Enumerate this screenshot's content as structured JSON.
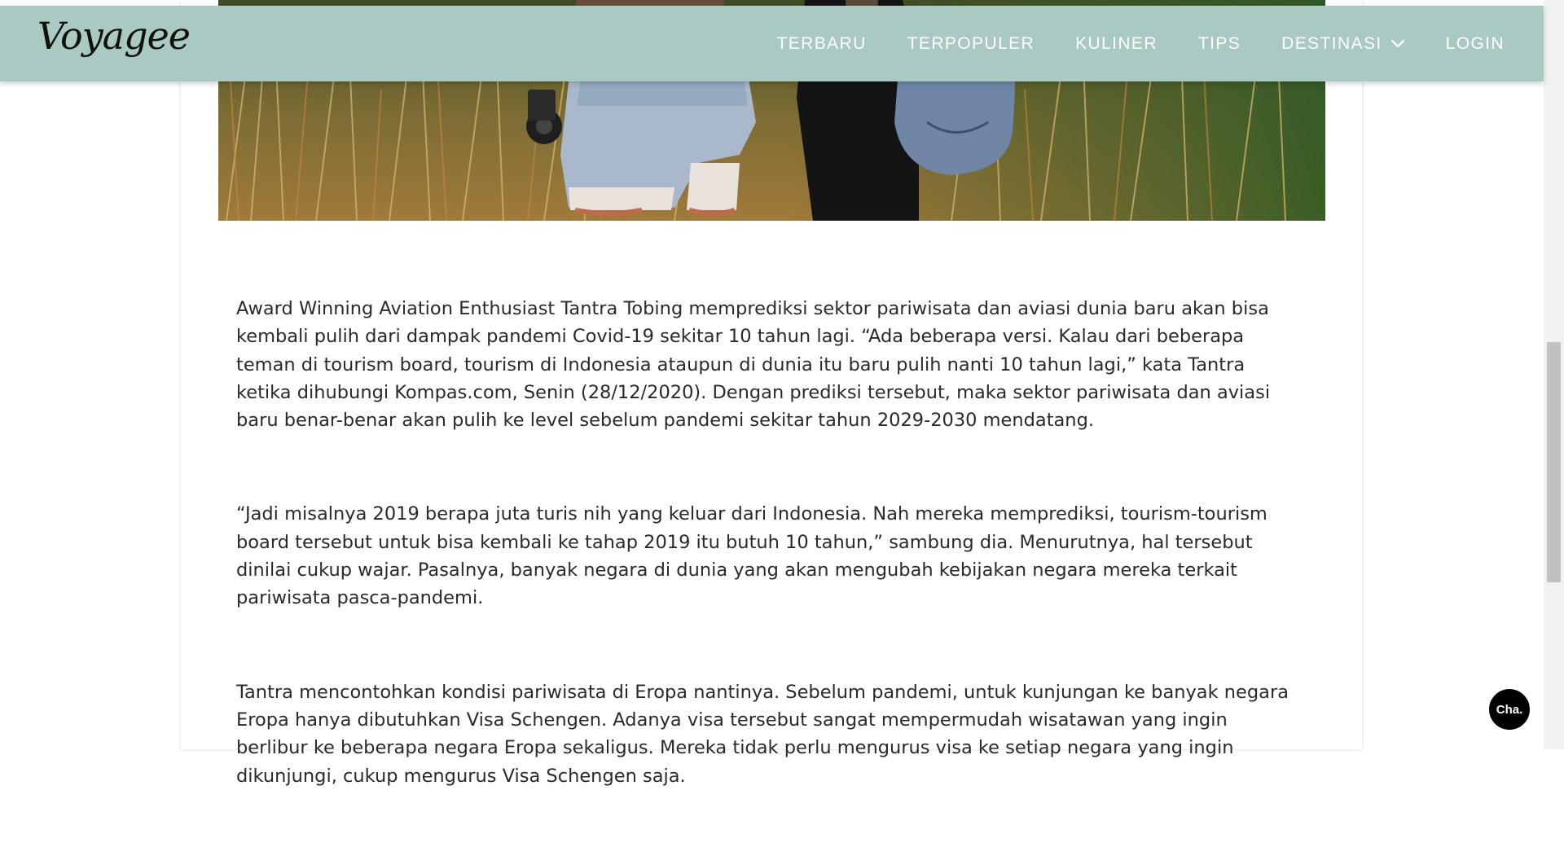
{
  "brand": {
    "logo_text": "Voyagee"
  },
  "nav": {
    "items": [
      {
        "label": "TERBARU"
      },
      {
        "label": "TERPOPULER"
      },
      {
        "label": "KULINER"
      },
      {
        "label": "TIPS"
      },
      {
        "label": "DESTINASI"
      },
      {
        "label": "LOGIN"
      }
    ]
  },
  "article": {
    "paragraphs": [
      "Award Winning Aviation Enthusiast Tantra Tobing memprediksi sektor pariwisata dan aviasi dunia baru akan bisa kembali pulih dari dampak pandemi Covid-19 sekitar 10 tahun lagi. “Ada beberapa versi. Kalau dari beberapa teman di tourism board, tourism di Indonesia ataupun di dunia itu baru pulih nanti 10 tahun lagi,” kata Tantra ketika dihubungi Kompas.com, Senin (28/12/2020). Dengan prediksi tersebut, maka sektor pariwisata dan aviasi baru benar-benar akan pulih ke level sebelum pandemi sekitar tahun 2029-2030 mendatang.",
      "“Jadi misalnya 2019 berapa juta turis nih yang keluar dari Indonesia. Nah mereka memprediksi, tourism-tourism board tersebut untuk bisa kembali ke tahap 2019 itu butuh 10 tahun,” sambung dia. Menurutnya, hal tersebut dinilai cukup wajar. Pasalnya, banyak negara di dunia yang akan mengubah kebijakan negara mereka terkait pariwisata pasca-pandemi.",
      "Tantra mencontohkan kondisi pariwisata di Eropa nantinya. Sebelum pandemi, untuk kunjungan ke banyak negara Eropa hanya dibutuhkan Visa Schengen. Adanya visa tersebut sangat mempermudah wisatawan yang ingin berlibur ke beberapa negara Eropa sekaligus. Mereka tidak perlu mengurus visa ke setiap negara yang ingin dikunjungi, cukup mengurus Visa Schengen saja."
    ]
  },
  "chat": {
    "label": "Cha."
  },
  "colors": {
    "navbar": "#a9c9c3",
    "nav_text": "#ffffff",
    "body_text": "#2a2a2a",
    "chat_bg": "#000000"
  },
  "icons": {
    "destinasi_dropdown": "chevron-down-icon"
  }
}
